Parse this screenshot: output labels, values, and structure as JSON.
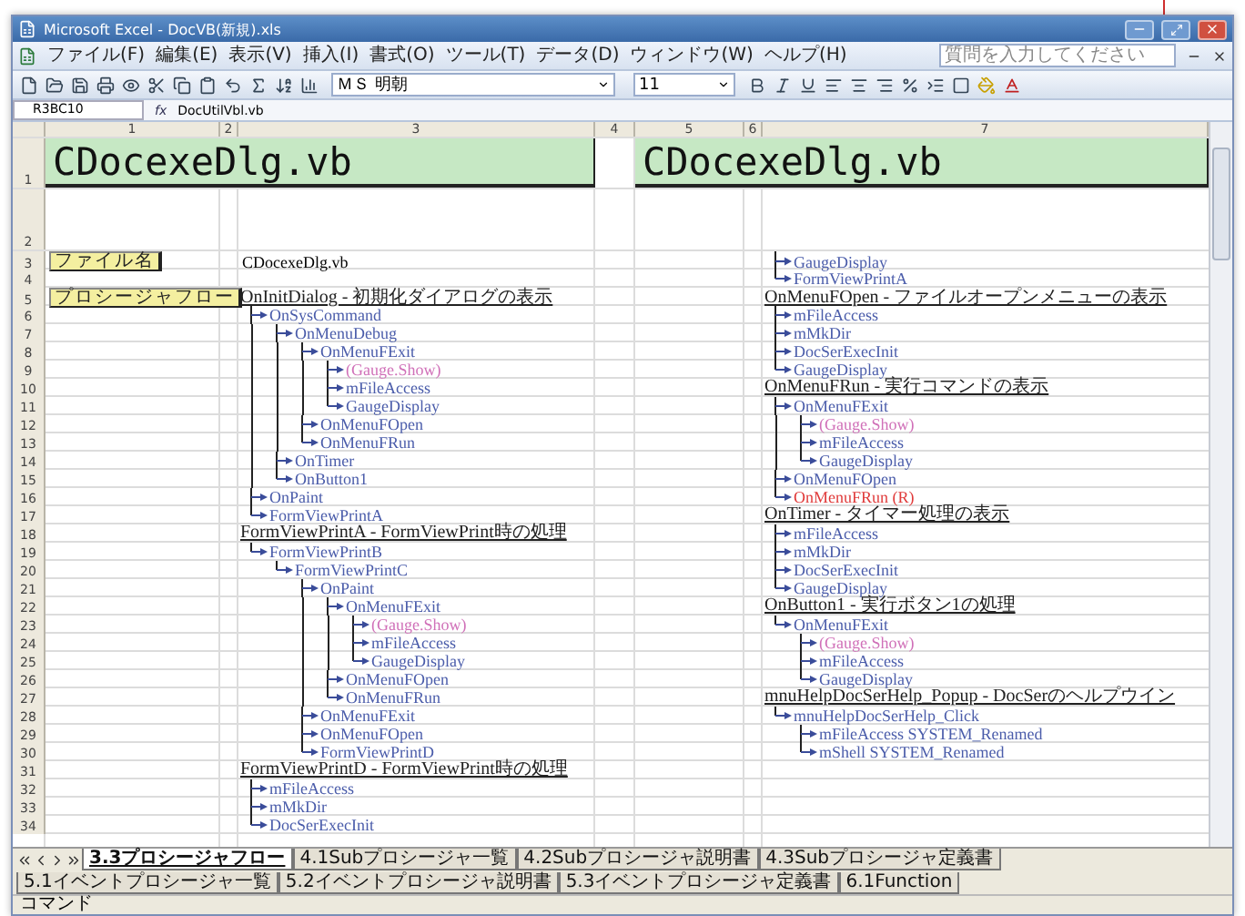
{
  "window": {
    "title": "Microsoft Excel - DocVB(新規).xls"
  },
  "menu": [
    "ファイル(F)",
    "編集(E)",
    "表示(V)",
    "挿入(I)",
    "書式(O)",
    "ツール(T)",
    "データ(D)",
    "ウィンドウ(W)",
    "ヘルプ(H)"
  ],
  "help_box": {
    "placeholder": "質問を入力してください"
  },
  "toolbar": {
    "font": "ＭＳ 明朝",
    "size": "11"
  },
  "formula_bar": {
    "name_box": "R3BC10",
    "fx": "fx",
    "formula": "DocUtilVbl.vb"
  },
  "column_headers": [
    "1",
    "2",
    "3",
    "4",
    "5",
    "6",
    "7"
  ],
  "row_numbers": [
    "1",
    "2",
    "3",
    "4",
    "5",
    "6",
    "7",
    "8",
    "9",
    "10",
    "11",
    "12",
    "13",
    "14",
    "15",
    "16",
    "17",
    "18",
    "19",
    "20",
    "21",
    "22",
    "23",
    "24",
    "25",
    "26",
    "27",
    "28",
    "29",
    "30",
    "31",
    "32",
    "33",
    "34"
  ],
  "title_cells": [
    "CDocexeDlg.vb",
    "CDocexeDlg.vb"
  ],
  "left_sections": [
    {
      "kind": "file",
      "label": "ファイル名",
      "text": "CDocexeDlg.vb"
    },
    {
      "kind": "blank"
    },
    {
      "kind": "procedure",
      "label": "プロシージャフロー",
      "text": "OnInitDialog - 初期化ダイアログの表示",
      "children": [
        {
          "text": "OnSysCommand",
          "color": "#4a5caa",
          "children": [
            {
              "text": "OnMenuDebug",
              "color": "#4a5caa",
              "children": [
                {
                  "text": "OnMenuFExit",
                  "color": "#4a5caa",
                  "children": [
                    {
                      "text": "(Gauge.Show)",
                      "color": "#d070b8"
                    },
                    {
                      "text": "mFileAccess",
                      "color": "#4a5caa"
                    },
                    {
                      "text": "GaugeDisplay",
                      "color": "#4a5caa"
                    }
                  ]
                },
                {
                  "text": "OnMenuFOpen",
                  "color": "#4a5caa"
                },
                {
                  "text": "OnMenuFRun",
                  "color": "#4a5caa"
                }
              ]
            },
            {
              "text": "OnTimer",
              "color": "#4a5caa"
            },
            {
              "text": "OnButton1",
              "color": "#4a5caa"
            }
          ]
        },
        {
          "text": "OnPaint",
          "color": "#4a5caa"
        },
        {
          "text": "FormViewPrintA",
          "color": "#4a5caa"
        }
      ]
    },
    {
      "kind": "procedure",
      "text": "FormViewPrintA - FormViewPrint時の処理",
      "children": [
        {
          "text": "FormViewPrintB",
          "color": "#4a5caa",
          "children": [
            {
              "text": "FormViewPrintC",
              "color": "#4a5caa",
              "children": [
                {
                  "text": "OnPaint",
                  "color": "#4a5caa",
                  "children": [
                    {
                      "text": "OnMenuFExit",
                      "color": "#4a5caa",
                      "children": [
                        {
                          "text": "(Gauge.Show)",
                          "color": "#d070b8"
                        },
                        {
                          "text": "mFileAccess",
                          "color": "#4a5caa"
                        },
                        {
                          "text": "GaugeDisplay",
                          "color": "#4a5caa"
                        }
                      ]
                    },
                    {
                      "text": "OnMenuFOpen",
                      "color": "#4a5caa"
                    },
                    {
                      "text": "OnMenuFRun",
                      "color": "#4a5caa"
                    }
                  ]
                },
                {
                  "text": "OnMenuFExit",
                  "color": "#4a5caa"
                },
                {
                  "text": "OnMenuFOpen",
                  "color": "#4a5caa"
                },
                {
                  "text": "FormViewPrintD",
                  "color": "#4a5caa"
                }
              ]
            }
          ]
        }
      ]
    },
    {
      "kind": "procedure",
      "text": "FormViewPrintD - FormViewPrint時の処理",
      "children": [
        {
          "text": "mFileAccess",
          "color": "#4a5caa"
        },
        {
          "text": "mMkDir",
          "color": "#4a5caa"
        },
        {
          "text": "DocSerExecInit",
          "color": "#4a5caa"
        }
      ]
    }
  ],
  "right_sections": [
    {
      "kind": "continuation",
      "children": [
        {
          "text": "GaugeDisplay",
          "color": "#4a5caa"
        },
        {
          "text": "FormViewPrintA",
          "color": "#4a5caa"
        }
      ]
    },
    {
      "kind": "procedure",
      "text": "OnMenuFOpen - ファイルオープンメニューの表示",
      "children": [
        {
          "text": "mFileAccess",
          "color": "#4a5caa"
        },
        {
          "text": "mMkDir",
          "color": "#4a5caa"
        },
        {
          "text": "DocSerExecInit",
          "color": "#4a5caa"
        },
        {
          "text": "GaugeDisplay",
          "color": "#4a5caa"
        }
      ]
    },
    {
      "kind": "procedure",
      "text": "OnMenuFRun - 実行コマンドの表示",
      "children": [
        {
          "text": "OnMenuFExit",
          "color": "#4a5caa",
          "children": [
            {
              "text": "(Gauge.Show)",
              "color": "#d070b8"
            },
            {
              "text": "mFileAccess",
              "color": "#4a5caa"
            },
            {
              "text": "GaugeDisplay",
              "color": "#4a5caa"
            }
          ]
        },
        {
          "text": "OnMenuFOpen",
          "color": "#4a5caa"
        },
        {
          "text": "OnMenuFRun (R)",
          "color": "#e03a3a"
        }
      ]
    },
    {
      "kind": "procedure",
      "text": "OnTimer - タイマー処理の表示",
      "children": [
        {
          "text": "mFileAccess",
          "color": "#4a5caa"
        },
        {
          "text": "mMkDir",
          "color": "#4a5caa"
        },
        {
          "text": "DocSerExecInit",
          "color": "#4a5caa"
        },
        {
          "text": "GaugeDisplay",
          "color": "#4a5caa"
        }
      ]
    },
    {
      "kind": "procedure",
      "text": "OnButton1 - 実行ボタン1の処理",
      "children": [
        {
          "text": "OnMenuFExit",
          "color": "#4a5caa",
          "children": [
            {
              "text": "(Gauge.Show)",
              "color": "#d070b8"
            },
            {
              "text": "mFileAccess",
              "color": "#4a5caa"
            },
            {
              "text": "GaugeDisplay",
              "color": "#4a5caa"
            }
          ]
        }
      ]
    },
    {
      "kind": "procedure",
      "text": "mnuHelpDocSerHelp_Popup - DocSerのヘルプウイン",
      "children": [
        {
          "text": "mnuHelpDocSerHelp_Click",
          "color": "#4a5caa",
          "children": [
            {
              "text": "mFileAccess SYSTEM_Renamed",
              "color": "#4a5caa"
            },
            {
              "text": "mShell SYSTEM_Renamed",
              "color": "#4a5caa"
            }
          ]
        }
      ]
    }
  ],
  "sheet_tabs": [
    {
      "label": "3.3プロシージャフロー",
      "selected": true
    },
    {
      "label": "4.1Subプロシージャ一覧",
      "selected": false
    },
    {
      "label": "4.2Subプロシージャ説明書",
      "selected": false
    },
    {
      "label": "4.3Subプロシージャ定義書",
      "selected": false
    },
    {
      "label": "5.1イベントプロシージャ一覧",
      "selected": false
    },
    {
      "label": "5.2イベントプロシージャ説明書",
      "selected": false
    },
    {
      "label": "5.3イベントプロシージャ定義書",
      "selected": false
    },
    {
      "label": "6.1Function",
      "selected": false
    }
  ],
  "status_bar": {
    "mode": "コマンド"
  }
}
